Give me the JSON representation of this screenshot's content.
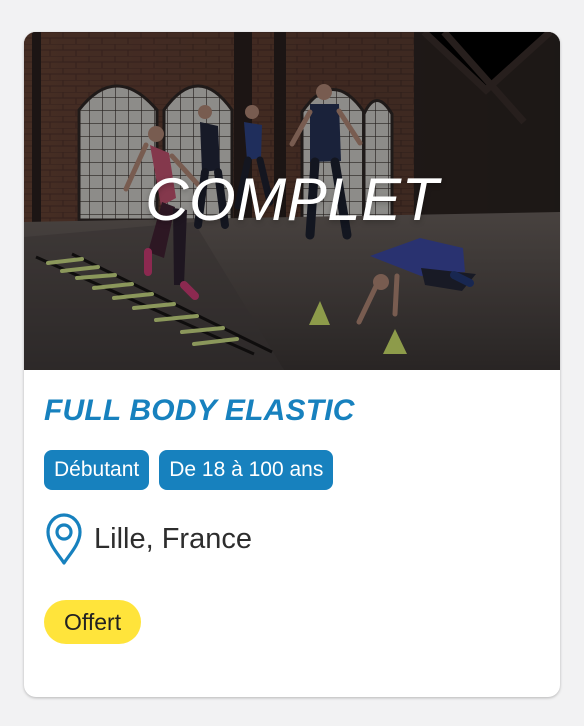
{
  "card": {
    "image": {
      "alt": "Fitness class training in a brick-walled studio",
      "overlay_text": "COMPLET"
    },
    "title": "FULL BODY ELASTIC",
    "tags": [
      {
        "label": "Débutant"
      },
      {
        "label": "De 18 à 100 ans"
      }
    ],
    "location": {
      "icon": "map-pin-icon",
      "text": "Lille, France"
    },
    "price": {
      "label": "Offert"
    }
  },
  "colors": {
    "primary": "#1781be",
    "badge_yellow": "#ffe43b",
    "text_dark": "#2d2d2d",
    "card_bg": "#ffffff",
    "page_bg": "#f2f2f3"
  }
}
